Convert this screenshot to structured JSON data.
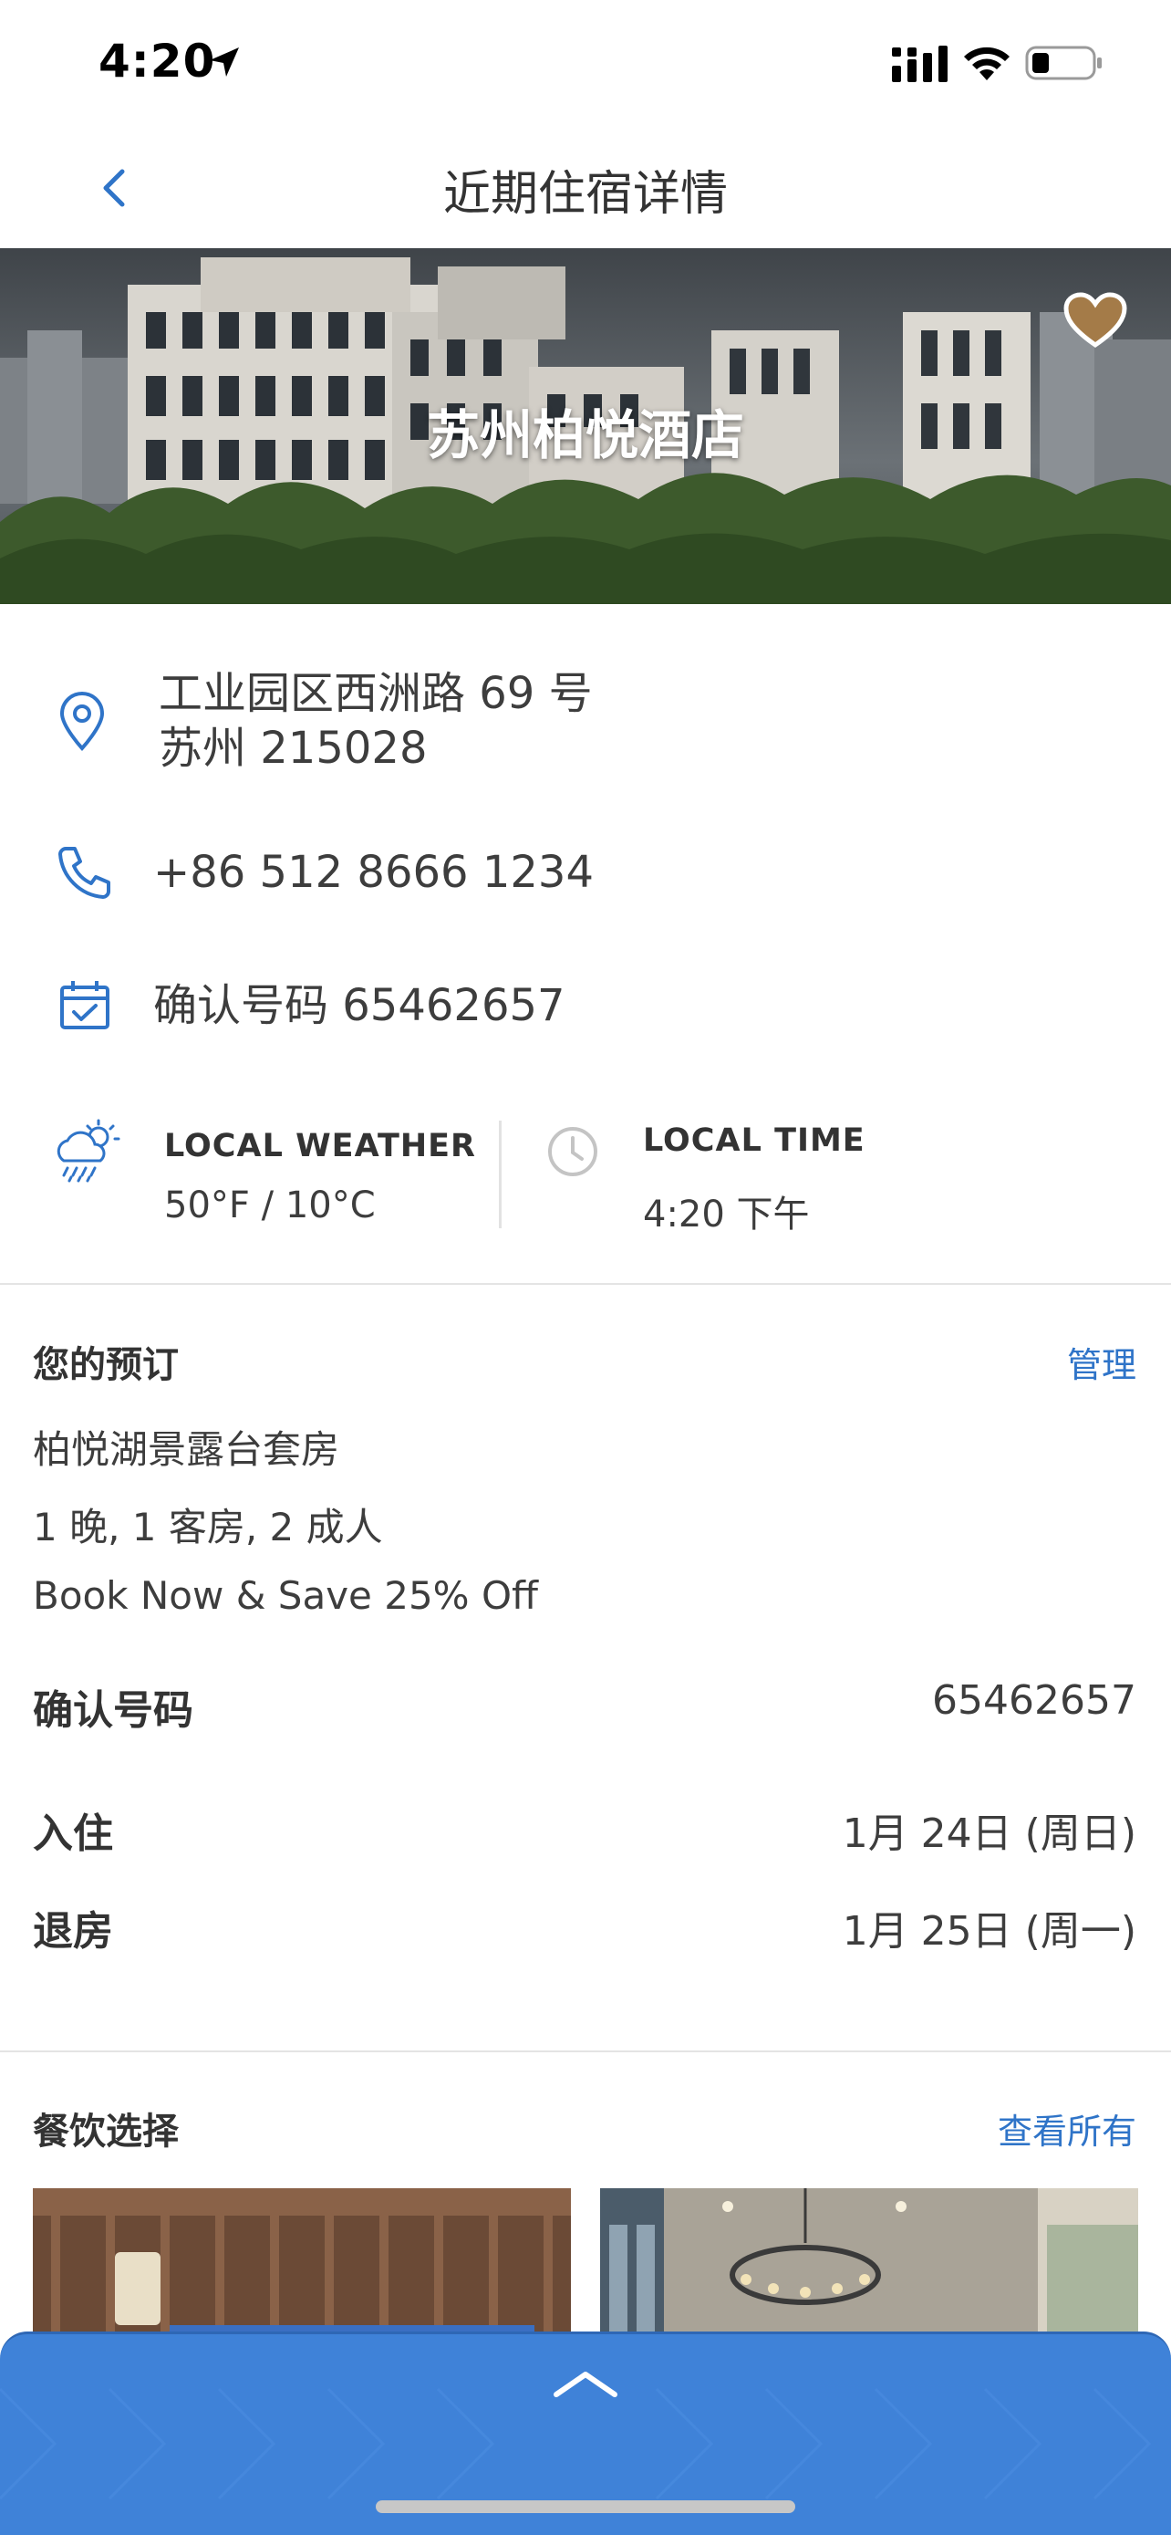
{
  "status_bar": {
    "time": "4:20",
    "icons": [
      "location-arrow-icon",
      "signal-icon",
      "wifi-icon",
      "battery-icon"
    ]
  },
  "nav": {
    "title": "近期住宿详情",
    "back_icon": "chevron-left-icon"
  },
  "hero": {
    "hotel_name": "苏州柏悦酒店",
    "favorite_icon": "heart-icon",
    "favorite_color": "#a47b48"
  },
  "info": {
    "address_line1": "工业园区西洲路 69 号",
    "address_line2": "苏州 215028",
    "phone": "+86 512 8666 1234",
    "confirmation_line": "确认号码 65462657",
    "icons": [
      "location-pin-icon",
      "phone-icon",
      "calendar-check-icon"
    ]
  },
  "weather": {
    "label": "LOCAL WEATHER",
    "value": "50°F / 10°C",
    "icon": "cloud-sun-rain-icon"
  },
  "local_time": {
    "label": "LOCAL TIME",
    "value": "4:20 下午",
    "icon": "clock-icon"
  },
  "reservation": {
    "title": "您的预订",
    "manage_link": "管理",
    "room": "柏悦湖景露台套房",
    "summary": "1 晚, 1 客房, 2  成人",
    "rate": "Book Now & Save 25% Off",
    "confirmation_label": "确认号码",
    "confirmation_value": "65462657",
    "checkin_label": "入住",
    "checkin_value": "1月 24日 (周日)",
    "checkout_label": "退房",
    "checkout_value": "1月 25日 (周一)"
  },
  "dining": {
    "title": "餐饮选择",
    "view_all_link": "查看所有"
  },
  "colors": {
    "accent_blue": "#2f74c8",
    "sheet_blue": "#3f82d8"
  },
  "bottom_sheet": {
    "expand_icon": "chevron-up-icon"
  }
}
